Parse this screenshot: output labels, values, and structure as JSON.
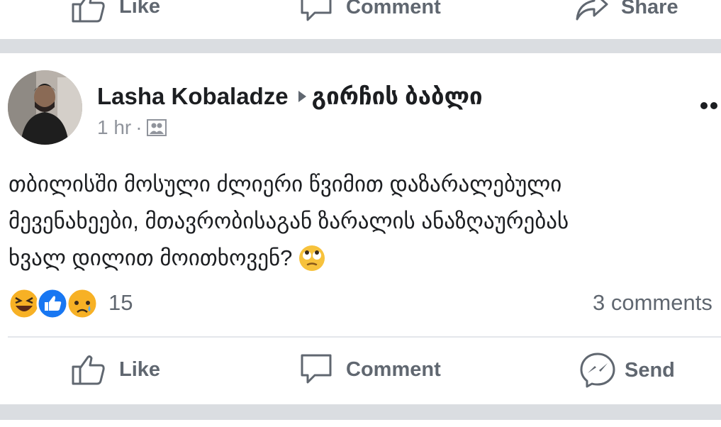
{
  "top_bar": {
    "like_label": "Like",
    "comment_label": "Comment",
    "share_label": "Share"
  },
  "post": {
    "author": "Lasha Kobaladze",
    "group": "გირჩის ბაბლი",
    "time": "1 hr",
    "meta_separator": "·",
    "audience_icon": "group-audience-icon",
    "text_lines": [
      "თბილისში მოსული ძლიერი წვიმით დაზარალებული",
      "მევენახეები, მთავრობისაგან ზარალის ანაზღაურებას",
      "ხვალ დილით მოითხოვენ?"
    ],
    "emoji": "face-with-rolling-eyes",
    "reactions": [
      "laughing-reaction",
      "like-reaction",
      "sad-reaction"
    ],
    "reaction_count": "15",
    "comment_count": "3 comments"
  },
  "action_bar": {
    "like_label": "Like",
    "comment_label": "Comment",
    "send_label": "Send"
  },
  "colors": {
    "like_blue": "#1877f2",
    "reaction_yellow": "#f7b125",
    "muted_text": "#606770",
    "divider": "#dadde1"
  }
}
